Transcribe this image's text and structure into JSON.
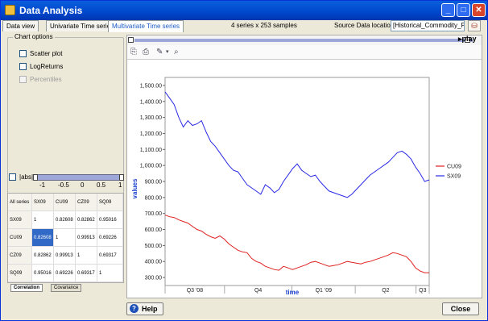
{
  "window": {
    "title": "Data Analysis"
  },
  "tabs": [
    {
      "label": "Data view"
    },
    {
      "label": "Univariate Time series"
    },
    {
      "label": "Multivariate Time series"
    }
  ],
  "info": {
    "samples": "4 series  x  253 samples",
    "source_label": "Source Data location :",
    "source_value": "[Historical_Commodity_Price"
  },
  "play_label": "▸play",
  "chart_options": {
    "legend": "Chart options",
    "scatter": "Scatter plot",
    "logreturns": "LogReturns",
    "percentiles": "Percentiles"
  },
  "abs_label": "|abs|",
  "slider_ticks": [
    "-1",
    "-0.5",
    "0",
    "0.5",
    "1"
  ],
  "corr_table": {
    "headers": [
      "All series",
      "SX09",
      "CU09",
      "CZ09",
      "SQ09"
    ],
    "rows": [
      [
        "SX09",
        "1",
        "0.82608",
        "0.82862",
        "0.95016"
      ],
      [
        "CU09",
        "0.82608",
        "1",
        "0.99913",
        "0.69226"
      ],
      [
        "CZ09",
        "0.82862",
        "0.99913",
        "1",
        "0.69317"
      ],
      [
        "SQ09",
        "0.95016",
        "0.69226",
        "0.69317",
        "1"
      ]
    ]
  },
  "bottom_tabs": [
    "Correlation",
    "Covariance"
  ],
  "buttons": {
    "help": "Help",
    "close": "Close"
  },
  "chart_data": {
    "type": "line",
    "xlabel": "time",
    "ylabel": "values",
    "ylim": [
      250,
      1550
    ],
    "yticks": [
      300,
      400,
      500,
      600,
      700,
      800,
      900,
      1000,
      1100,
      1200,
      1300,
      1400,
      1500
    ],
    "ytick_labels": [
      "300.00",
      "400.00",
      "500.00",
      "600.00",
      "700.00",
      "800.00",
      "900.00",
      "1,000.00",
      "1,100.00",
      "1,200.00",
      "1,300.00",
      "1,400.00",
      "1,500.00"
    ],
    "xtick_labels": [
      "Q3 '08",
      "Q4",
      "Q1 '09",
      "Q2",
      "Q3"
    ],
    "legend_position": "right",
    "grid": false,
    "series": [
      {
        "name": "CU09",
        "color": "#e02020",
        "values": [
          690,
          680,
          675,
          660,
          650,
          640,
          620,
          600,
          590,
          570,
          555,
          545,
          560,
          540,
          510,
          490,
          470,
          460,
          455,
          420,
          400,
          390,
          370,
          360,
          350,
          345,
          370,
          360,
          350,
          360,
          370,
          380,
          395,
          400,
          390,
          380,
          370,
          375,
          380,
          390,
          400,
          395,
          390,
          385,
          395,
          400,
          410,
          420,
          430,
          440,
          455,
          450,
          440,
          430,
          400,
          360,
          340,
          330,
          330
        ]
      },
      {
        "name": "SX09",
        "color": "#2a2ae6",
        "values": [
          1460,
          1420,
          1380,
          1300,
          1240,
          1280,
          1250,
          1260,
          1280,
          1210,
          1150,
          1120,
          1080,
          1040,
          1000,
          970,
          960,
          920,
          880,
          860,
          840,
          820,
          880,
          860,
          830,
          850,
          900,
          940,
          980,
          1010,
          970,
          950,
          930,
          940,
          900,
          870,
          840,
          830,
          820,
          810,
          800,
          820,
          850,
          880,
          910,
          940,
          960,
          980,
          1000,
          1020,
          1050,
          1080,
          1090,
          1070,
          1040,
          990,
          950,
          900,
          910
        ]
      }
    ]
  }
}
